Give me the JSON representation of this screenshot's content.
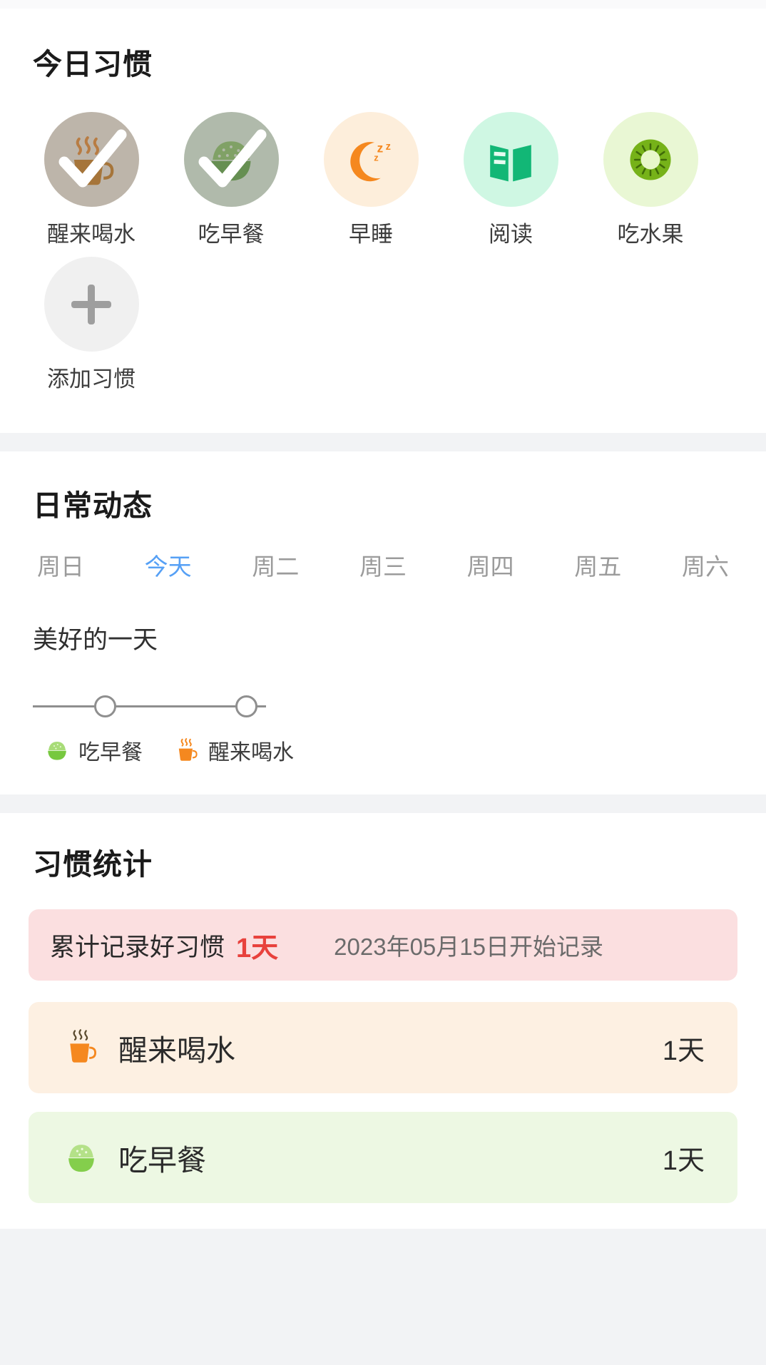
{
  "today_habits": {
    "title": "今日习惯",
    "items": [
      {
        "label": "醒来喝水",
        "icon": "coffee-cup-icon",
        "bg": "#FDEEDB",
        "done": true
      },
      {
        "label": "吃早餐",
        "icon": "rice-bowl-icon",
        "bg": "#E6F7DC",
        "done": true
      },
      {
        "label": "早睡",
        "icon": "sleeping-moon-icon",
        "bg": "#FDEEDB",
        "done": false
      },
      {
        "label": "阅读",
        "icon": "open-book-icon",
        "bg": "#CFF7E3",
        "done": false
      },
      {
        "label": "吃水果",
        "icon": "kiwi-fruit-icon",
        "bg": "#E9F7D4",
        "done": false
      }
    ],
    "add_label": "添加习惯",
    "add_icon": "plus-icon"
  },
  "daily_dynamics": {
    "title": "日常动态",
    "weekdays": [
      {
        "label": "周日",
        "active": false
      },
      {
        "label": "今天",
        "active": true
      },
      {
        "label": "周二",
        "active": false
      },
      {
        "label": "周三",
        "active": false
      },
      {
        "label": "周四",
        "active": false
      },
      {
        "label": "周五",
        "active": false
      },
      {
        "label": "周六",
        "active": false
      }
    ],
    "timeline_title": "美好的一天",
    "timeline_events": [
      {
        "label": "吃早餐",
        "icon": "rice-bowl-icon"
      },
      {
        "label": "醒来喝水",
        "icon": "coffee-cup-icon"
      }
    ]
  },
  "habit_stats": {
    "title": "习惯统计",
    "banner": {
      "label": "累计记录好习惯",
      "days": "1天",
      "since": "2023年05月15日开始记录",
      "bg": "#FBDFE0",
      "days_color": "#E8413C"
    },
    "rows": [
      {
        "name": "醒来喝水",
        "days": "1天",
        "icon": "coffee-cup-icon",
        "bg": "#FDF0E2"
      },
      {
        "name": "吃早餐",
        "days": "1天",
        "icon": "rice-bowl-icon",
        "bg": "#EDF8E3"
      }
    ]
  },
  "colors": {
    "accent_blue": "#56A0F5",
    "page_bg": "#F2F3F5",
    "card_bg": "#FFFFFF",
    "orange": "#F5881F",
    "green": "#12B776",
    "kiwi_green": "#76B219"
  }
}
